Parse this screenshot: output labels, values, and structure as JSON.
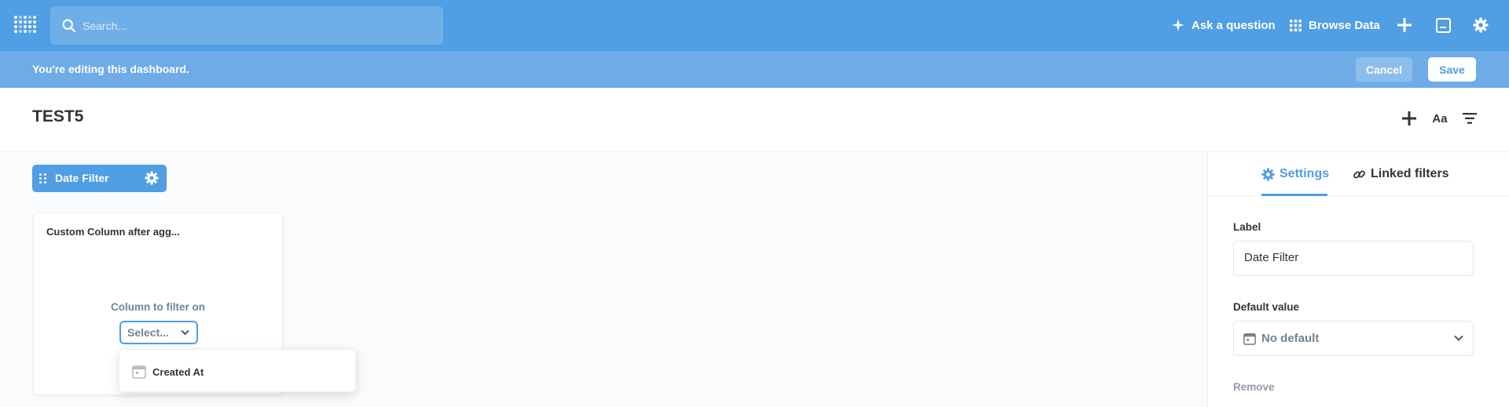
{
  "navbar": {
    "search_placeholder": "Search...",
    "ask_question": "Ask a question",
    "browse_data": "Browse Data"
  },
  "editbar": {
    "message": "You're editing this dashboard.",
    "cancel": "Cancel",
    "save": "Save"
  },
  "dashboard": {
    "title": "TEST5"
  },
  "filter_pill": {
    "label": "Date Filter"
  },
  "card": {
    "title": "Custom Column after agg...",
    "column_label": "Column to filter on",
    "select_placeholder": "Select...",
    "options": [
      "Created At"
    ]
  },
  "sidebar": {
    "tabs": [
      {
        "label": "Settings",
        "icon": "gear-icon",
        "active": true
      },
      {
        "label": "Linked filters",
        "icon": "link-icon",
        "active": false
      }
    ],
    "label_field": {
      "label": "Label",
      "value": "Date Filter"
    },
    "default_value": {
      "label": "Default value",
      "value": "No default"
    },
    "remove": "Remove"
  },
  "colors": {
    "brand": "#509ee3",
    "editbar": "#6eabe7",
    "text_dark": "#2e353b",
    "text_medium": "#74838f"
  }
}
